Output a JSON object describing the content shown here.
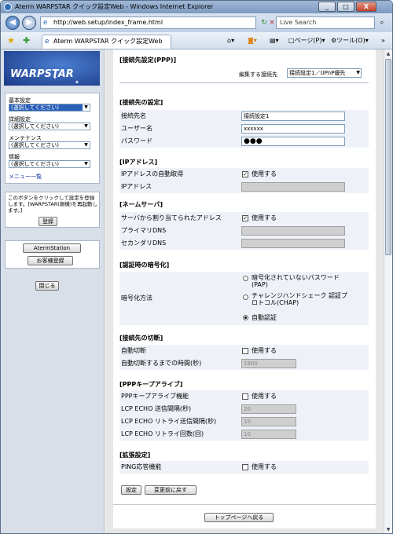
{
  "window": {
    "title": "Aterm WARPSTAR クイック設定Web - Windows Internet Explorer",
    "min": "_",
    "max": "□",
    "close": "X"
  },
  "browser": {
    "url": "http://web.setup/index_frame.html",
    "search_placeholder": "Live Search",
    "tab_title": "Aterm WARPSTAR クイック設定Web",
    "page_menu": "ページ(P)",
    "tools_menu": "ツール(O)",
    "refresh": "↻",
    "stop": "×"
  },
  "sidebar": {
    "logo": "WARPSTAR",
    "menus": [
      {
        "label": "基本設定",
        "value": "(選択してください)",
        "active": true
      },
      {
        "label": "詳細設定",
        "value": "(選択してください)"
      },
      {
        "label": "メンテナンス",
        "value": "(選択してください)"
      },
      {
        "label": "情報",
        "value": "(選択してください)"
      }
    ],
    "menu_list": "メニュー一覧",
    "register_note": "このボタンをクリックして設定を登録します。[WARPSTAR(親機)を再起動します。]",
    "register_button": "登録",
    "aterm_station_button": "AtermStation",
    "customer_register_button": "お客様登録",
    "close_button": "閉じる"
  },
  "main": {
    "header_title": "[接続先設定(PPP)]",
    "edit_label": "編集する接続先",
    "edit_value": "接続設定1／UPnP優先",
    "sections": {
      "conn": {
        "title": "[接続先の設定]",
        "name_label": "接続先名",
        "name_value": "接続設定1",
        "user_label": "ユーザー名",
        "user_value": "xxxxxx",
        "pw_label": "パスワード",
        "pw_value": "●●●"
      },
      "ip": {
        "title": "[IPアドレス]",
        "auto_label": "IPアドレスの自動取得",
        "auto_check": "使用する",
        "ip_label": "IPアドレス"
      },
      "dns": {
        "title": "[ネームサーバ]",
        "auto_label": "サーバから割り当てられたアドレス",
        "auto_check": "使用する",
        "primary_label": "プライマリDNS",
        "secondary_label": "セカンダリDNS"
      },
      "auth": {
        "title": "[認証時の暗号化]",
        "method_label": "暗号化方法",
        "opt1": "暗号化されていないパスワード (PAP)",
        "opt2": "チャレンジハンドシェーク 認証プロトコル(CHAP)",
        "opt3": "自動認証"
      },
      "disc": {
        "title": "[接続先の切断]",
        "auto_label": "自動切断",
        "auto_check": "使用する",
        "time_label": "自動切断するまでの時間(秒)",
        "time_value": "1800"
      },
      "keep": {
        "title": "[PPPキープアライブ]",
        "func_label": "PPPキープアライブ機能",
        "func_check": "使用する",
        "interval_label": "LCP ECHO 送信間隔(秒)",
        "interval_value": "20",
        "retry_int_label": "LCP ECHO リトライ送信間隔(秒)",
        "retry_int_value": "10",
        "retry_cnt_label": "LCP ECHO リトライ回数(回)",
        "retry_cnt_value": "10"
      },
      "ext": {
        "title": "[拡張設定]",
        "ping_label": "PING応答機能",
        "ping_check": "使用する"
      }
    },
    "set_button": "設定",
    "revert_button": "変更前に戻す",
    "top_button": "トップページへ戻る"
  }
}
